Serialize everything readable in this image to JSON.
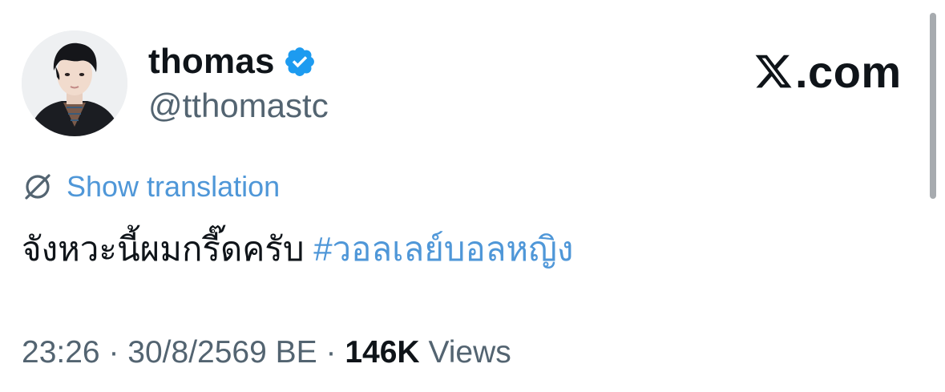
{
  "author": {
    "display_name": "thomas",
    "handle": "@tthomastc",
    "verified": true
  },
  "brand": {
    "label": "X.com"
  },
  "translation": {
    "link_label": "Show translation"
  },
  "post": {
    "text": "จังหวะนี้ผมกรี๊ดครับ",
    "hashtag": "#วอลเลย์บอลหญิง"
  },
  "meta": {
    "time": "23:26",
    "separator": "·",
    "date": "30/8/2569 BE",
    "views_count": "146K",
    "views_label": "Views"
  },
  "colors": {
    "link": "#4f97d8",
    "verified": "#1d9bf0",
    "secondary_text": "#536471",
    "primary_text": "#0f1419"
  }
}
